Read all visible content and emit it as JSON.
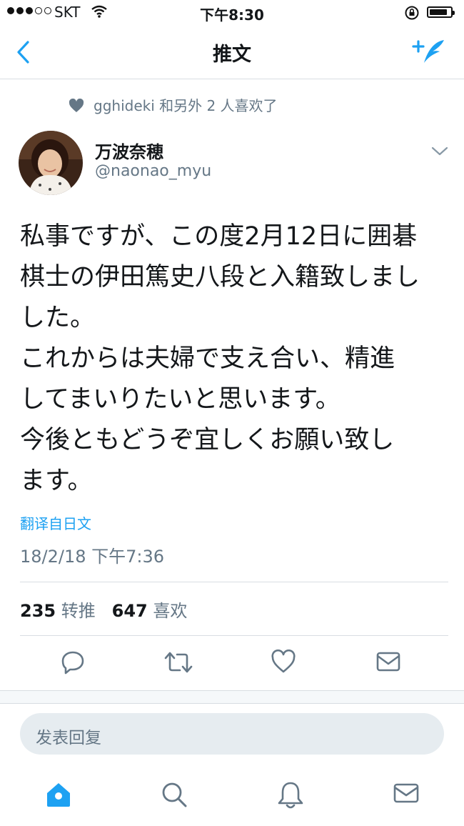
{
  "status_bar": {
    "carrier": "SKT",
    "time": "下午8:30",
    "battery_level": 0.85,
    "signal_bars_filled": 3,
    "signal_bars_total": 5
  },
  "nav": {
    "title": "推文",
    "back_icon": "chevron-left-icon",
    "compose_icon": "compose-tweet-icon"
  },
  "social_context": {
    "text": "gghideki 和另外 2 人喜欢了"
  },
  "author": {
    "name": "万波奈穂",
    "handle": "@naonao_myu"
  },
  "tweet": {
    "lines": [
      "私事ですが、この度2月12日に囲碁",
      "棋士の伊田篤史八段と入籍致しまし",
      "した。",
      "これからは夫婦で支え合い、精進",
      "してまいりたいと思います。",
      "今後ともどうぞ宜しくお願い致し",
      "ます。"
    ],
    "translate_label": "翻译自日文",
    "timestamp": "18/2/18 下午7:36"
  },
  "stats": {
    "retweets": "235",
    "retweets_label": "转推",
    "likes": "647",
    "likes_label": "喜欢"
  },
  "reply": {
    "placeholder": "发表回复"
  },
  "colors": {
    "accent": "#1da1f2",
    "secondary_text": "#657786",
    "icon_gray": "#657786",
    "divider": "#d8dde2"
  }
}
